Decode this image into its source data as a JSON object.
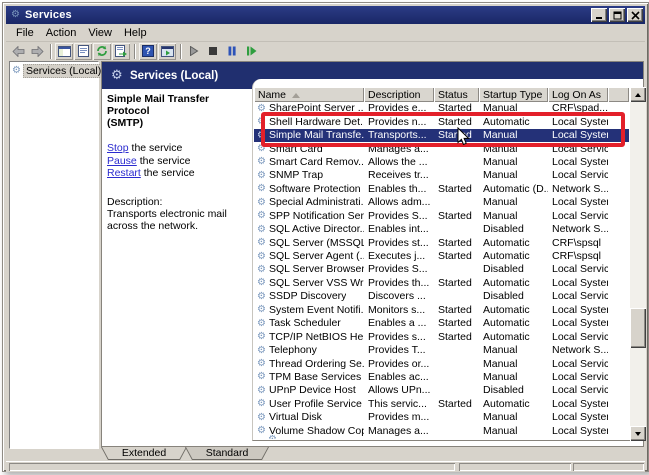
{
  "window": {
    "title": "Services"
  },
  "titlebar_controls": {
    "minimize": "minimize",
    "maximize": "maximize",
    "close": "close"
  },
  "menu": {
    "items": [
      "File",
      "Action",
      "View",
      "Help"
    ]
  },
  "toolbar": {
    "icons": [
      "back",
      "forward",
      "show-console-tree",
      "properties-document",
      "refresh",
      "export-list",
      "help",
      "show-action-pane",
      "start-service",
      "stop-service",
      "pause-service",
      "restart-service"
    ]
  },
  "tree": {
    "root_label": "Services (Local)"
  },
  "banner": {
    "title": "Services (Local)"
  },
  "detail_pane": {
    "title_line1": "Simple Mail Transfer Protocol",
    "title_line2": "(SMTP)",
    "actions": [
      {
        "link": "Stop",
        "suffix": " the service"
      },
      {
        "link": "Pause",
        "suffix": " the service"
      },
      {
        "link": "Restart",
        "suffix": " the service"
      }
    ],
    "description_label": "Description:",
    "description_text": "Transports electronic mail across the network."
  },
  "table": {
    "columns": [
      "Name",
      "Description",
      "Status",
      "Startup Type",
      "Log On As"
    ],
    "sort": {
      "column": "Name",
      "direction": "ascending"
    },
    "rows": [
      {
        "name": "SharePoint Server ...",
        "description": "Provides e...",
        "status": "Started",
        "startup": "Manual",
        "logon": "CRF\\spad..."
      },
      {
        "name": "Shell Hardware Det...",
        "description": "Provides n...",
        "status": "Started",
        "startup": "Automatic",
        "logon": "Local System"
      },
      {
        "name": "Simple Mail Transfe...",
        "description": "Transports...",
        "status": "Started",
        "startup": "Manual",
        "logon": "Local System",
        "selected": true
      },
      {
        "name": "Smart Card",
        "description": "Manages a...",
        "status": "",
        "startup": "Manual",
        "logon": "Local Service"
      },
      {
        "name": "Smart Card Remov...",
        "description": "Allows the ...",
        "status": "",
        "startup": "Manual",
        "logon": "Local System"
      },
      {
        "name": "SNMP Trap",
        "description": "Receives tr...",
        "status": "",
        "startup": "Manual",
        "logon": "Local Service"
      },
      {
        "name": "Software Protection",
        "description": "Enables th...",
        "status": "Started",
        "startup": "Automatic (D...",
        "logon": "Network S..."
      },
      {
        "name": "Special Administrati...",
        "description": "Allows adm...",
        "status": "",
        "startup": "Manual",
        "logon": "Local System"
      },
      {
        "name": "SPP Notification Ser...",
        "description": "Provides S...",
        "status": "Started",
        "startup": "Manual",
        "logon": "Local Service"
      },
      {
        "name": "SQL Active Director...",
        "description": "Enables int...",
        "status": "",
        "startup": "Disabled",
        "logon": "Network S..."
      },
      {
        "name": "SQL Server (MSSQL...",
        "description": "Provides st...",
        "status": "Started",
        "startup": "Automatic",
        "logon": "CRF\\spsql"
      },
      {
        "name": "SQL Server Agent (...",
        "description": "Executes j...",
        "status": "Started",
        "startup": "Automatic",
        "logon": "CRF\\spsql"
      },
      {
        "name": "SQL Server Browser",
        "description": "Provides S...",
        "status": "",
        "startup": "Disabled",
        "logon": "Local Service"
      },
      {
        "name": "SQL Server VSS Wri...",
        "description": "Provides th...",
        "status": "Started",
        "startup": "Automatic",
        "logon": "Local System"
      },
      {
        "name": "SSDP Discovery",
        "description": "Discovers ...",
        "status": "",
        "startup": "Disabled",
        "logon": "Local Service"
      },
      {
        "name": "System Event Notifi...",
        "description": "Monitors s...",
        "status": "Started",
        "startup": "Automatic",
        "logon": "Local System"
      },
      {
        "name": "Task Scheduler",
        "description": "Enables a ...",
        "status": "Started",
        "startup": "Automatic",
        "logon": "Local System"
      },
      {
        "name": "TCP/IP NetBIOS He...",
        "description": "Provides s...",
        "status": "Started",
        "startup": "Automatic",
        "logon": "Local Service"
      },
      {
        "name": "Telephony",
        "description": "Provides T...",
        "status": "",
        "startup": "Manual",
        "logon": "Network S..."
      },
      {
        "name": "Thread Ordering Se...",
        "description": "Provides or...",
        "status": "",
        "startup": "Manual",
        "logon": "Local Service"
      },
      {
        "name": "TPM Base Services",
        "description": "Enables ac...",
        "status": "",
        "startup": "Manual",
        "logon": "Local Service"
      },
      {
        "name": "UPnP Device Host",
        "description": "Allows UPn...",
        "status": "",
        "startup": "Disabled",
        "logon": "Local Service"
      },
      {
        "name": "User Profile Service",
        "description": "This servic...",
        "status": "Started",
        "startup": "Automatic",
        "logon": "Local System"
      },
      {
        "name": "Virtual Disk",
        "description": "Provides m...",
        "status": "",
        "startup": "Manual",
        "logon": "Local System"
      },
      {
        "name": "Volume Shadow Copy",
        "description": "Manages a...",
        "status": "",
        "startup": "Manual",
        "logon": "Local System"
      }
    ]
  },
  "tabs": [
    {
      "label": "Extended",
      "active": true
    },
    {
      "label": "Standard",
      "active": false
    }
  ],
  "annotation": {
    "type": "red-rectangle",
    "color": "#e3202a"
  },
  "colors": {
    "title_navy": "#202f6f",
    "selection_navy": "#243178",
    "chrome_gray": "#d7d3cb",
    "link_blue": "#2b2bcf",
    "annotation_red": "#e3202a"
  }
}
